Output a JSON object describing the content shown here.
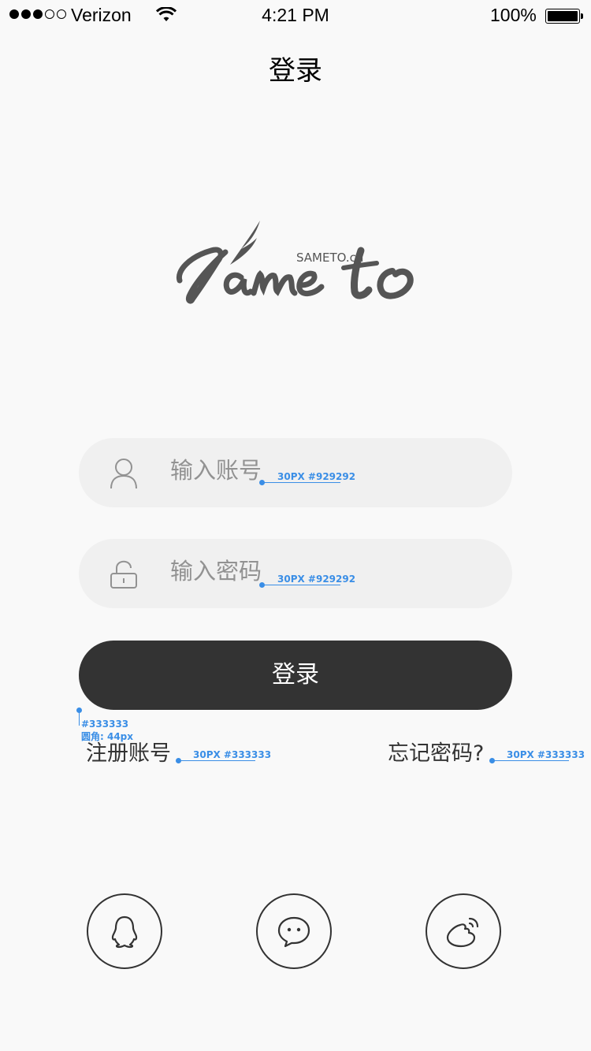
{
  "status_bar": {
    "carrier": "Verizon",
    "time": "4:21 PM",
    "battery": "100%"
  },
  "nav": {
    "title": "登录"
  },
  "logo": {
    "text": "Same to",
    "small": "SAMETO.cn"
  },
  "form": {
    "account_placeholder": "输入账号",
    "password_placeholder": "输入密码",
    "login_label": "登录"
  },
  "links": {
    "register": "注册账号",
    "forgot": "忘记密码?"
  },
  "annotations": {
    "account_spec": "30PX #929292",
    "password_spec": "30PX #929292",
    "button_color": "#333333",
    "button_radius": "圆角: 44px",
    "register_spec": "30PX #333333",
    "forgot_spec": "30PX #333333"
  },
  "social": [
    "qq-icon",
    "wechat-icon",
    "weibo-icon"
  ],
  "colors": {
    "primary": "#333333",
    "placeholder": "#929292",
    "field_bg": "#f0f0f0",
    "annotation": "#3a8ee6"
  }
}
